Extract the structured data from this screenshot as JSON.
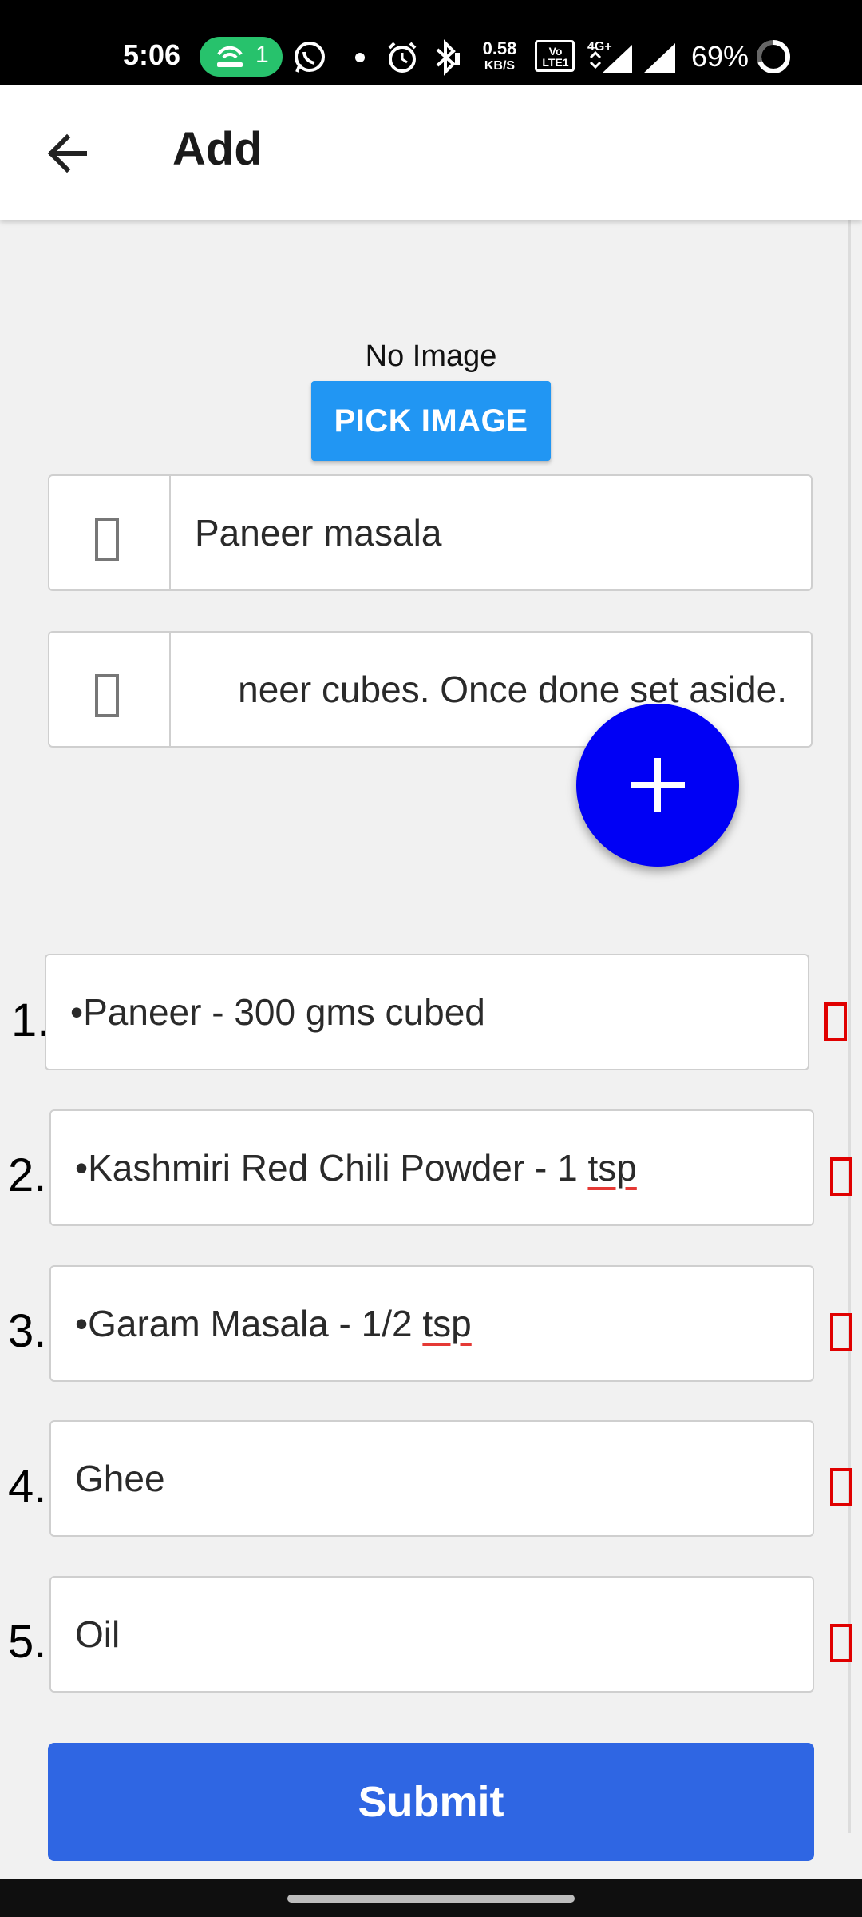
{
  "status_bar": {
    "time": "5:06",
    "hotspot_count": "1",
    "network_speed_value": "0.58",
    "network_speed_unit": "KB/S",
    "volte_label": "Vo LTE1",
    "network_type": "4G+",
    "battery_percent": "69%"
  },
  "appbar": {
    "title": "Add"
  },
  "image_picker": {
    "status": "No Image",
    "button_label": "PICK IMAGE"
  },
  "form": {
    "name_value": "Paneer masala",
    "description_value": "neer cubes. Once done set aside."
  },
  "ingredients": [
    {
      "num": "1.",
      "text": "•Paneer - 300 gms cubed"
    },
    {
      "num": "2.",
      "text_plain": "•Kashmiri Red Chili Powder - 1 ",
      "text_flag": "tsp"
    },
    {
      "num": "3.",
      "text_plain": "•Garam Masala - 1/2 ",
      "text_flag": "tsp"
    },
    {
      "num": "4.",
      "text": "Ghee"
    },
    {
      "num": "5.",
      "text": "Oil"
    }
  ],
  "submit_label": "Submit",
  "colors": {
    "accent_blue": "#2196f3",
    "fab_blue": "#0000f5",
    "submit_blue": "#2f66e3",
    "delete_red": "#e00000",
    "hotspot_green": "#27c26c"
  },
  "icons": {
    "back": "arrow-left-icon",
    "fab": "plus-icon",
    "delete": "delete-icon",
    "name_field": "missing-glyph-icon",
    "description_field": "missing-glyph-icon"
  }
}
